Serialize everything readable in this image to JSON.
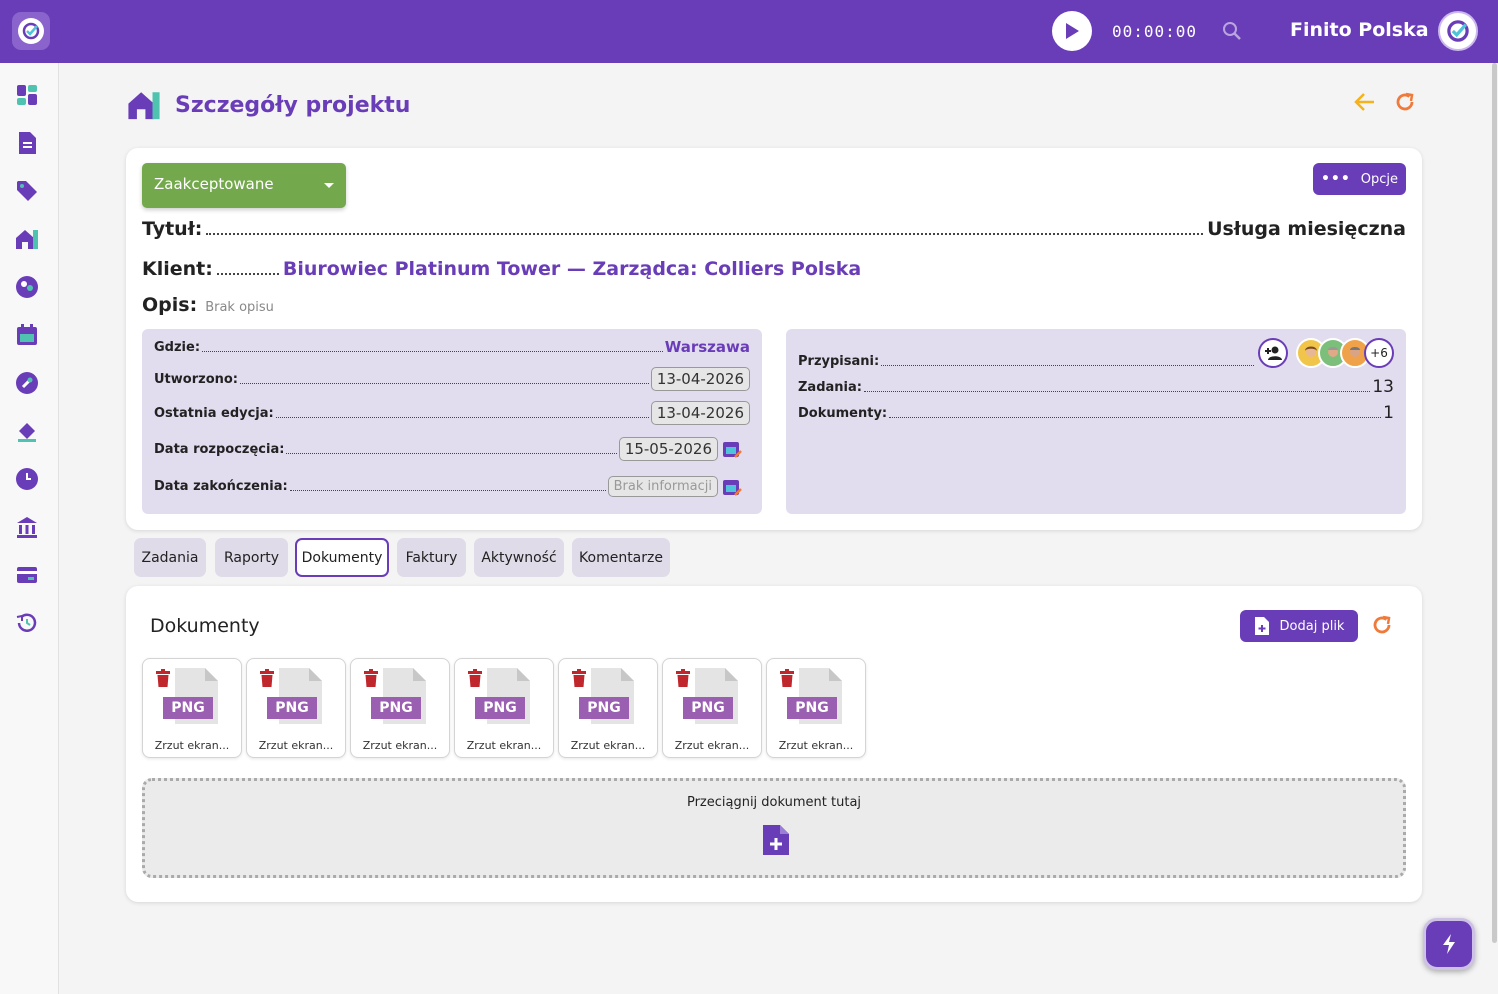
{
  "topbar": {
    "timer": "00:00:00",
    "company": "Finito Polska"
  },
  "sidebar": {
    "items": [
      {
        "icon": "dashboard-icon"
      },
      {
        "icon": "document-icon"
      },
      {
        "icon": "tag-icon"
      },
      {
        "icon": "projects-icon"
      },
      {
        "icon": "clients-icon"
      },
      {
        "icon": "calendar-icon"
      },
      {
        "icon": "wrench-icon"
      },
      {
        "icon": "paint-bucket-icon"
      },
      {
        "icon": "clock-icon"
      },
      {
        "icon": "bank-icon"
      },
      {
        "icon": "card-icon"
      },
      {
        "icon": "history-icon"
      }
    ]
  },
  "page": {
    "title": "Szczegóły projektu"
  },
  "project": {
    "status": "Zaakceptowane",
    "options_label": "Opcje",
    "title_label": "Tytuł:",
    "title_value": "Usługa miesięczna",
    "client_label": "Klient:",
    "client_value": "Biurowiec Platinum Tower — Zarządca: Colliers Polska",
    "desc_label": "Opis:",
    "desc_value": "Brak opisu",
    "where_label": "Gdzie:",
    "where_value": "Warszawa",
    "created_label": "Utworzono:",
    "created_value": "13-04-2026",
    "edited_label": "Ostatnia edycja:",
    "edited_value": "13-04-2026",
    "start_label": "Data rozpoczęcia:",
    "start_value": "15-05-2026",
    "end_label": "Data zakończenia:",
    "end_value": "Brak informacji",
    "assigned_label": "Przypisani:",
    "assigned_more": "+6",
    "tasks_label": "Zadania:",
    "tasks_value": "13",
    "docs_label": "Dokumenty:",
    "docs_value": "1"
  },
  "tabs": [
    {
      "label": "Zadania"
    },
    {
      "label": "Raporty"
    },
    {
      "label": "Dokumenty"
    },
    {
      "label": "Faktury"
    },
    {
      "label": "Aktywność"
    },
    {
      "label": "Komentarze"
    }
  ],
  "documents": {
    "title": "Dokumenty",
    "add_label": "Dodaj plik",
    "files": [
      {
        "ext": "PNG",
        "name": "Zrzut ekran..."
      },
      {
        "ext": "PNG",
        "name": "Zrzut ekran..."
      },
      {
        "ext": "PNG",
        "name": "Zrzut ekran..."
      },
      {
        "ext": "PNG",
        "name": "Zrzut ekran..."
      },
      {
        "ext": "PNG",
        "name": "Zrzut ekran..."
      },
      {
        "ext": "PNG",
        "name": "Zrzut ekran..."
      },
      {
        "ext": "PNG",
        "name": "Zrzut ekran..."
      }
    ],
    "dropzone_text": "Przeciągnij dokument tutaj"
  },
  "colors": {
    "brand": "#6a3db8",
    "status_green": "#73a84c",
    "accent_orange": "#f07a3a",
    "trash_red": "#c0272d"
  }
}
